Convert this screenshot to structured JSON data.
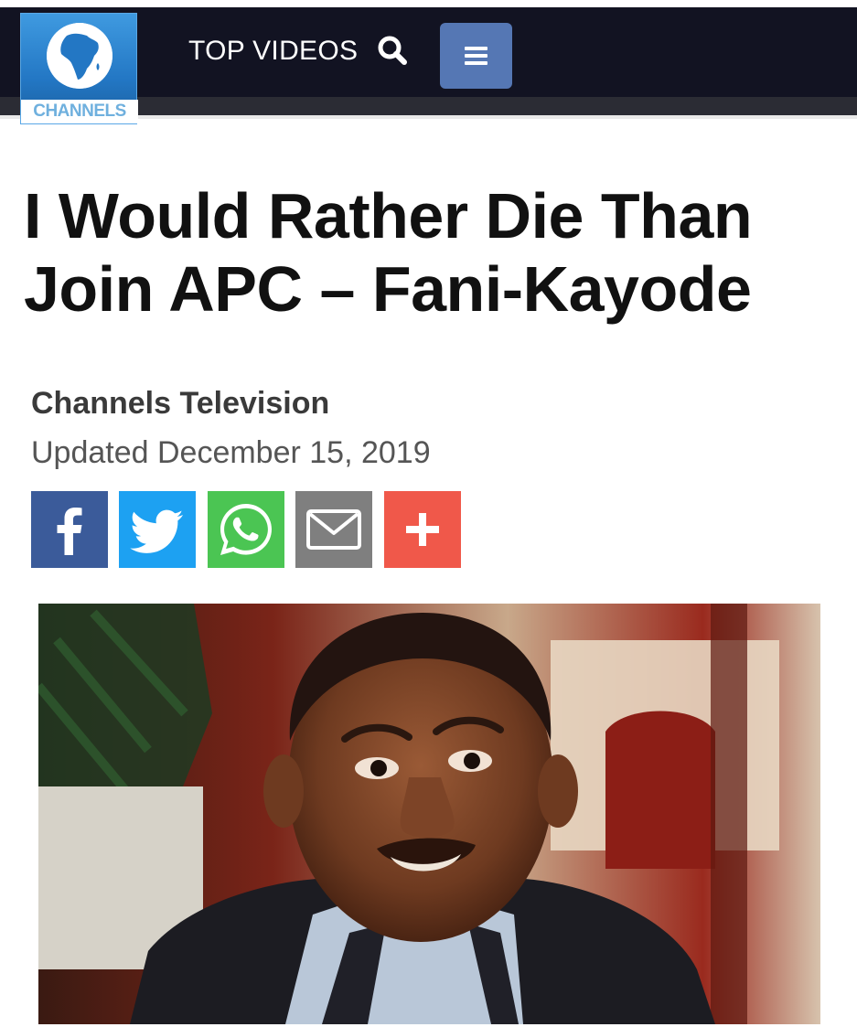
{
  "header": {
    "logo_text": "CHANNELS",
    "nav_label": "TOP VIDEOS",
    "icons": {
      "search": "search-icon",
      "menu": "hamburger-menu-icon"
    },
    "colors": {
      "bar": "#121322",
      "menu_button": "#5577b4"
    }
  },
  "article": {
    "title": "I Would Rather Die Than Join APC – Fani-Kayode",
    "author": "Channels Television",
    "updated": "Updated December 15, 2019"
  },
  "share": {
    "buttons": [
      {
        "icon": "facebook-icon",
        "color": "#3b5b9a"
      },
      {
        "icon": "twitter-icon",
        "color": "#1da1f2"
      },
      {
        "icon": "whatsapp-icon",
        "color": "#4bc553"
      },
      {
        "icon": "email-icon",
        "color": "#7f7f7f"
      },
      {
        "icon": "plus-icon",
        "color": "#f0584a"
      }
    ]
  }
}
